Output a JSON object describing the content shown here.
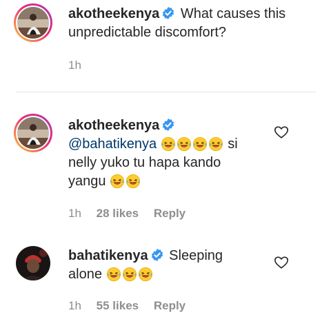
{
  "comments": [
    {
      "username": "akotheekenya",
      "verified": true,
      "text": "What causes this unpredictable discomfort?",
      "time": "1h"
    },
    {
      "username": "akotheekenya",
      "verified": true,
      "mention": "@bahatikenya",
      "text_line1": "si",
      "text_line2": "nelly yuko tu hapa kando",
      "text_line3": "yangu",
      "emoji_after_mention": 4,
      "emoji_after_text": 2,
      "time": "1h",
      "likes": "28 likes",
      "reply": "Reply"
    },
    {
      "username": "bahatikenya",
      "verified": true,
      "text_line1": "Sleeping",
      "text_line2": "alone",
      "emoji_after_text": 3,
      "time": "1h",
      "likes": "55 likes",
      "reply": "Reply"
    }
  ],
  "icons": {
    "verified": "verified-badge-icon",
    "emoji": "rolling-on-floor-laughing-emoji",
    "like": "heart-outline-icon"
  },
  "colors": {
    "verified": "#3897f0",
    "mention": "#00376b",
    "meta": "#8e8e8e"
  }
}
